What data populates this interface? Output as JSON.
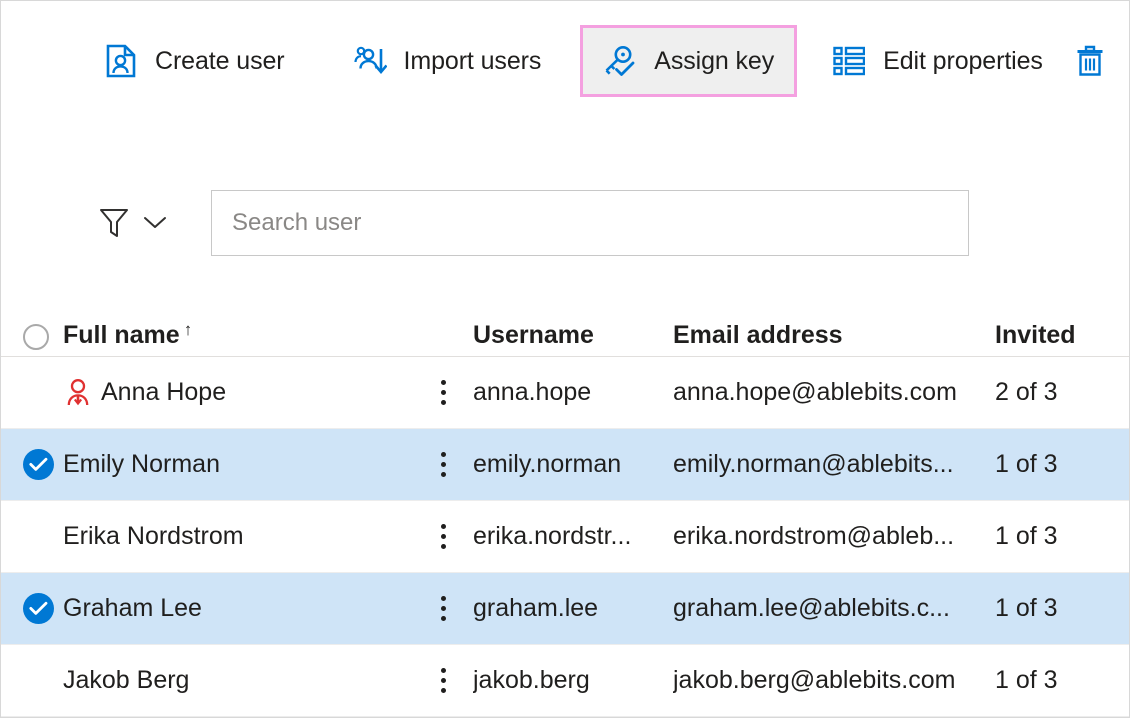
{
  "toolbar": {
    "items": [
      {
        "label": "Create user",
        "icon": "create-user-icon",
        "highlighted": false
      },
      {
        "label": "Import users",
        "icon": "import-users-icon",
        "highlighted": false
      },
      {
        "label": "Assign key",
        "icon": "assign-key-icon",
        "highlighted": true
      },
      {
        "label": "Edit properties",
        "icon": "edit-properties-icon",
        "highlighted": false
      }
    ],
    "delete_icon": "trash-icon",
    "highlight_border_color": "#f4a0e0",
    "highlight_background_color": "#efefef",
    "icon_color": "#0078d4"
  },
  "filterbar": {
    "filter_icon": "funnel-icon",
    "caret_icon": "chevron-down-icon",
    "search": {
      "placeholder": "Search user",
      "value": ""
    }
  },
  "table": {
    "columns": {
      "select": "",
      "full_name": "Full name",
      "sort_indicator": "↑",
      "username": "Username",
      "email": "Email address",
      "invited": "Invited"
    },
    "select_all_state": "unchecked",
    "selection_color": "#cfe4f7",
    "accent_color": "#0078d4",
    "warning_color": "#e03131",
    "rows": [
      {
        "selected": false,
        "warning": true,
        "full_name": "Anna Hope",
        "username": "anna.hope",
        "email": "anna.hope@ablebits.com",
        "invited": "2 of 3"
      },
      {
        "selected": true,
        "warning": false,
        "full_name": "Emily Norman",
        "username": "emily.norman",
        "email": "emily.norman@ablebits...",
        "invited": "1 of 3"
      },
      {
        "selected": false,
        "warning": false,
        "full_name": "Erika Nordstrom",
        "username": "erika.nordstr...",
        "email": "erika.nordstrom@ableb...",
        "invited": "1 of 3"
      },
      {
        "selected": true,
        "warning": false,
        "full_name": "Graham Lee",
        "username": "graham.lee",
        "email": "graham.lee@ablebits.c...",
        "invited": "1 of 3"
      },
      {
        "selected": false,
        "warning": false,
        "full_name": "Jakob Berg",
        "username": "jakob.berg",
        "email": "jakob.berg@ablebits.com",
        "invited": "1 of 3"
      }
    ]
  }
}
